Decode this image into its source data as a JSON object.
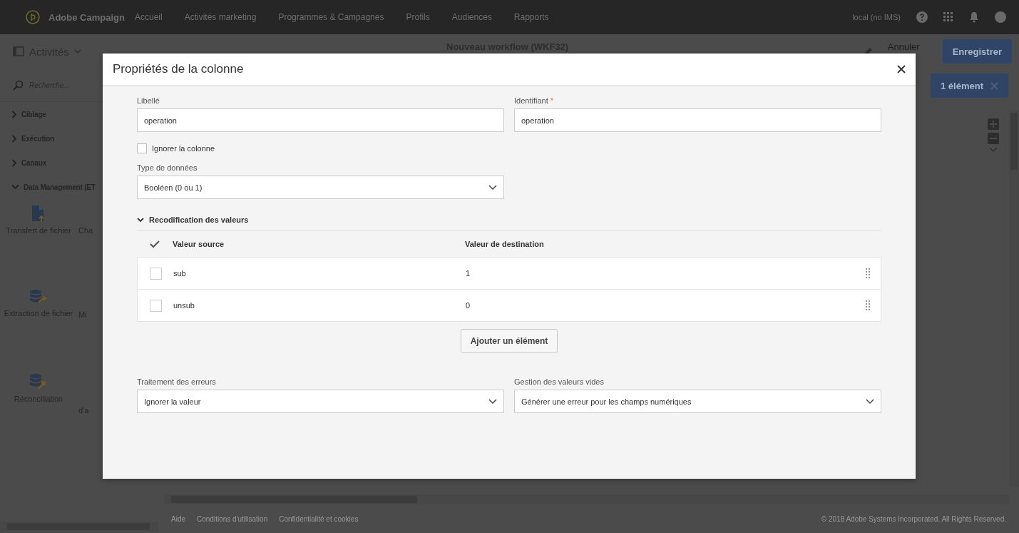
{
  "top_nav": {
    "brand": "Adobe Campaign",
    "items": [
      "Accueil",
      "Activités marketing",
      "Programmes & Campagnes",
      "Profils",
      "Audiences",
      "Rapports"
    ],
    "instance": "local (no IMS)"
  },
  "toolbar": {
    "panel_title": "Activités",
    "workflow_title": "Nouveau workflow (WKF32)",
    "cancel": "Annuler",
    "save": "Enregistrer"
  },
  "sidebar": {
    "search_placeholder": "Recherche...",
    "categories": [
      {
        "label": "Ciblage",
        "expanded": false
      },
      {
        "label": "Exécution",
        "expanded": false
      },
      {
        "label": "Canaux",
        "expanded": false
      },
      {
        "label": "Data Management (ET",
        "expanded": true
      }
    ],
    "activities": [
      {
        "label": "Transfert de fichier",
        "kind": "file"
      },
      {
        "label": "Cha",
        "kind": "cut"
      },
      {
        "label": "Extraction de fichier",
        "kind": "export"
      },
      {
        "label": "Mi",
        "kind": "cut"
      },
      {
        "label": "Réconciliation",
        "kind": "key"
      },
      {
        "label": "d'a",
        "kind": "cut-wrapped"
      }
    ]
  },
  "selection_button": "1 élément",
  "footer": {
    "links": [
      "Aide",
      "Conditions d'utilisation",
      "Confidentialité et cookies"
    ],
    "copyright": "© 2018 Adobe Systems Incorporated. All Rights Reserved."
  },
  "dialog": {
    "title": "Propriétés de la colonne",
    "required_marker": "*",
    "fields": [
      {
        "label": "Libellé",
        "value": "operation",
        "required": false
      },
      {
        "label": "Identifiant",
        "value": "operation",
        "required": true
      }
    ],
    "ignore_column": {
      "label": "Ignorer la colonne",
      "checked": false
    },
    "data_type": {
      "label": "Type de données",
      "value": "Booléen (0 ou 1)"
    },
    "recoding": {
      "title": "Recodification des valeurs",
      "expanded": true,
      "columns": [
        "Valeur source",
        "Valeur de destination"
      ],
      "rows": [
        {
          "source": "sub",
          "destination": "1",
          "selected": false
        },
        {
          "source": "unsub",
          "destination": "0",
          "selected": false
        }
      ],
      "add_button": "Ajouter un élément"
    },
    "bottom_selects": [
      {
        "label": "Traitement des erreurs",
        "value": "Ignorer la valeur"
      },
      {
        "label": "Gestion des valeurs vides",
        "value": "Générer une erreur pour les champs numériques"
      }
    ]
  }
}
